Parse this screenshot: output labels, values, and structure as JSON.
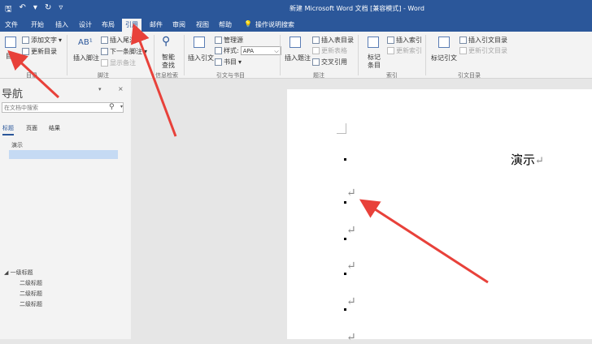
{
  "title": "新建 Microsoft Word 文档 [兼容模式] - Word",
  "qat": [
    "save-icon",
    "undo-icon",
    "redo-icon",
    "customize-icon"
  ],
  "tabs": [
    "文件",
    "开始",
    "插入",
    "设计",
    "布局",
    "引用",
    "邮件",
    "审阅",
    "视图",
    "帮助"
  ],
  "active_tab": "引用",
  "tell_me": "操作说明搜索",
  "ribbon": {
    "toc": {
      "label": "目录",
      "add_text": "添加文字",
      "update": "更新目录",
      "group": "目录"
    },
    "footnotes": {
      "insert_footnote": "插入脚注",
      "insert_endnote": "插入尾注",
      "next_footnote": "下一条脚注",
      "show_notes": "显示备注",
      "group": "脚注"
    },
    "research": {
      "smart_lookup_1": "智能",
      "smart_lookup_2": "查找",
      "group": "信息检索"
    },
    "citations": {
      "insert_citation": "插入引文",
      "manage_sources": "管理源",
      "style_label": "样式:",
      "style_value": "APA",
      "bibliography": "书目",
      "group": "引文与书目"
    },
    "captions": {
      "insert_caption": "插入题注",
      "insert_tof": "插入表目录",
      "update_table": "更新表格",
      "cross_ref": "交叉引用",
      "group": "题注"
    },
    "index": {
      "mark_entry_1": "标记",
      "mark_entry_2": "条目",
      "insert_index": "插入索引",
      "update_index": "更新索引",
      "group": "索引"
    },
    "toa": {
      "mark_citation": "标记引文",
      "insert_toa": "插入引文目录",
      "update_toa": "更新引文目录",
      "group": "引文目录"
    }
  },
  "nav": {
    "title": "导航",
    "search_placeholder": "在文档中搜索",
    "tabs": [
      "标题",
      "页面",
      "结果"
    ],
    "headings": [
      {
        "text": "演示",
        "level": 1
      }
    ],
    "outline": [
      {
        "text": "一级标题",
        "level": 1
      },
      {
        "text": "二级标题",
        "level": 2
      },
      {
        "text": "二级标题",
        "level": 2
      },
      {
        "text": "二级标题",
        "level": 2
      }
    ]
  },
  "doc": {
    "heading": "演示"
  },
  "colors": {
    "accent": "#2b579a",
    "arrow": "#e8413a"
  }
}
